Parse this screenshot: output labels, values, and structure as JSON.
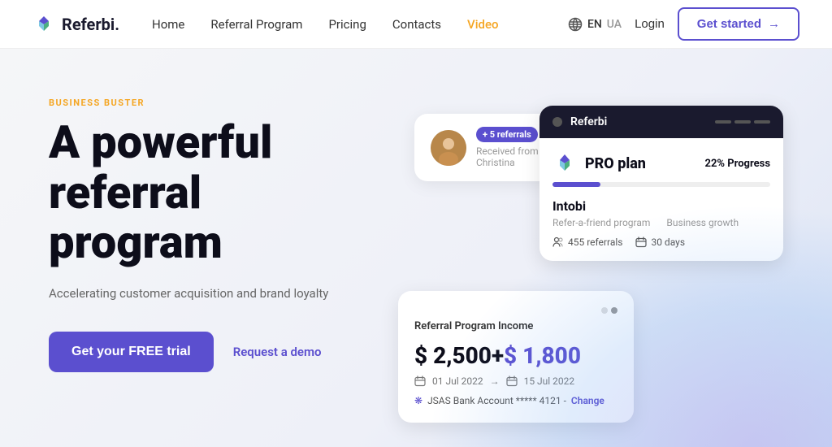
{
  "nav": {
    "logo_text": "Referbi.",
    "links": [
      {
        "label": "Home",
        "key": "home",
        "active": false
      },
      {
        "label": "Referral Program",
        "key": "referral-program",
        "active": false
      },
      {
        "label": "Pricing",
        "key": "pricing",
        "active": false
      },
      {
        "label": "Contacts",
        "key": "contacts",
        "active": false
      },
      {
        "label": "Video",
        "key": "video",
        "active": true
      }
    ],
    "lang_active": "EN",
    "lang_inactive": "UA",
    "login": "Login",
    "get_started": "Get started"
  },
  "hero": {
    "eyebrow": "BUSINESS BUSTER",
    "title_line1": "A powerful",
    "title_line2": "referral",
    "title_line3": "program",
    "subtitle": "Accelerating customer acquisition and brand loyalty",
    "cta_primary": "Get your FREE trial",
    "cta_secondary": "Request a demo"
  },
  "card_referral": {
    "badge": "+ 5 referrals",
    "from": "Received from Christina"
  },
  "card_pro": {
    "header_title": "Referbi",
    "plan_name": "PRO plan",
    "progress_pct": "22%",
    "progress_label": "Progress",
    "company": "Intobi",
    "sub1": "Refer-a-friend program",
    "sub2": "Business growth",
    "referrals": "455 referrals",
    "days": "30 days"
  },
  "card_income": {
    "title": "Referral Program Income",
    "amount_base": "$ 2,500",
    "plus": "+",
    "amount_highlight": "$ 1,800",
    "date_from": "01 Jul 2022",
    "date_to": "15 Jul 2022",
    "bank_text": "JSAS Bank Account ***** 4121 -",
    "change": "Change"
  }
}
